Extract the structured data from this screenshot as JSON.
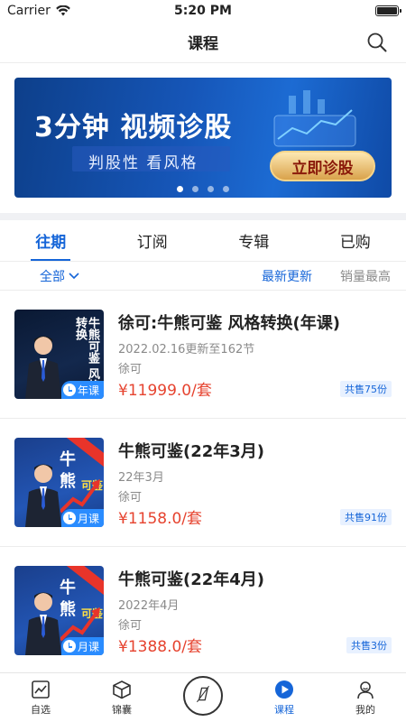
{
  "status_bar": {
    "carrier": "Carrier",
    "time": "5:20 PM"
  },
  "nav": {
    "title": "课程"
  },
  "banner": {
    "title": "3分钟 视频诊股",
    "subtitle": "判股性  看风格",
    "cta": "立即诊股",
    "page_count": 4,
    "active_page": 1
  },
  "tabs": [
    {
      "label": "往期",
      "active": true
    },
    {
      "label": "订阅",
      "active": false
    },
    {
      "label": "专辑",
      "active": false
    },
    {
      "label": "已购",
      "active": false
    }
  ],
  "filters": {
    "all": "全部",
    "sort_latest": "最新更新",
    "sort_sales": "销量最高"
  },
  "courses": [
    {
      "title": "徐可:牛熊可鉴 风格转换(年课)",
      "update": "2022.02.16更新至162节",
      "author": "徐可",
      "price": "¥11999.0/套",
      "sold": "共售75份",
      "badge": "年课",
      "thumb_text": "牛熊可鉴 风格转换"
    },
    {
      "title": "牛熊可鉴(22年3月)",
      "update": "22年3月",
      "author": "徐可",
      "price": "¥1158.0/套",
      "sold": "共售91份",
      "badge": "月课",
      "thumb_char1": "牛",
      "thumb_char2": "熊",
      "thumb_small": "可鉴"
    },
    {
      "title": "牛熊可鉴(22年4月)",
      "update": "2022年4月",
      "author": "徐可",
      "price": "¥1388.0/套",
      "sold": "共售3份",
      "badge": "月课",
      "thumb_char1": "牛",
      "thumb_char2": "熊",
      "thumb_small": "可鉴"
    }
  ],
  "tabbar": [
    {
      "label": "自选",
      "icon": "chart-icon",
      "active": false
    },
    {
      "label": "锦囊",
      "icon": "box-icon",
      "active": false
    },
    {
      "label": "",
      "icon": "center-logo-icon",
      "active": false
    },
    {
      "label": "课程",
      "icon": "play-icon",
      "active": true
    },
    {
      "label": "我的",
      "icon": "user-icon",
      "active": false
    }
  ],
  "colors": {
    "accent": "#1565d8",
    "price": "#e6432f"
  }
}
